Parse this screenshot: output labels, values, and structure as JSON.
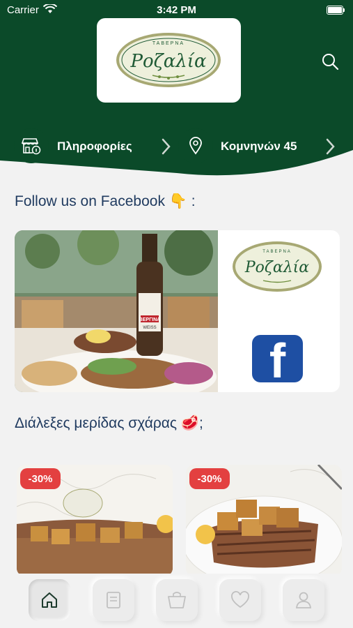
{
  "status_bar": {
    "carrier": "Carrier",
    "time": "3:42 PM",
    "battery_level": 0.9
  },
  "brand": {
    "small_text": "ΤΑΒΕΡΝΑ",
    "name": "Ροζαλία"
  },
  "info_row": {
    "info_label": "Πληροφορίες",
    "address_label": "Κομνηνών 45"
  },
  "sections": {
    "facebook_title": "Follow us on Facebook 👇 :",
    "grill_title": "Διάλεξες μερίδας σχάρας 🥩;"
  },
  "facebook_card": {
    "beer_label": "ΒΕΡΓΙΝΑ",
    "beer_sublabel": "WEISS",
    "fb_letter": "f"
  },
  "products": [
    {
      "discount": "-30%"
    },
    {
      "discount": "-30%"
    }
  ],
  "tabbar": {
    "active": "home"
  },
  "colors": {
    "header_green": "#0b4a29",
    "title_blue": "#1f3a5f",
    "badge_red": "#e34040",
    "facebook_blue": "#1e4fa3"
  }
}
